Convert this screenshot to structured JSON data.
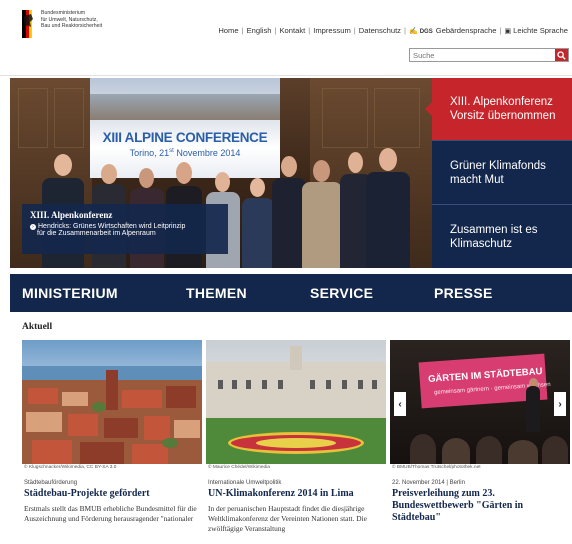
{
  "header": {
    "ministry_lines": [
      "Bundesministerium",
      "für Umwelt, Naturschutz,",
      "Bau und Reaktorsicherheit"
    ],
    "topnav": [
      {
        "label": "Home",
        "icon": ""
      },
      {
        "label": "English",
        "icon": ""
      },
      {
        "label": "Kontakt",
        "icon": ""
      },
      {
        "label": "Impressum",
        "icon": ""
      },
      {
        "label": "Datenschutz",
        "icon": ""
      },
      {
        "label": "Gebärdensprache",
        "icon": "sign-language-icon",
        "prefix": "DGS"
      },
      {
        "label": "Leichte Sprache",
        "icon": "easy-language-icon"
      }
    ],
    "search": {
      "placeholder": "Suche"
    }
  },
  "hero": {
    "banner": {
      "title": "XIII ALPINE CONFERENCE",
      "subtitle_city": "Torino, 21",
      "subtitle_sup": "st",
      "subtitle_rest": " Novembre 2014"
    },
    "caption": {
      "title": "XIII. Alpenkonferenz",
      "line1": "Hendricks: Grünes Wirtschaften wird Leitprinzip",
      "line2": "für die Zusammenarbeit im Alpenraum"
    },
    "teasers": [
      {
        "line1": "XIII. Alpenkonferenz",
        "line2": "Vorsitz übernommen",
        "active": true
      },
      {
        "line1": "Grüner Klimafonds",
        "line2": "macht Mut",
        "active": false
      },
      {
        "line1": "Zusammen ist es",
        "line2": "Klimaschutz",
        "active": false
      }
    ]
  },
  "mainnav": [
    "MINISTERIUM",
    "THEMEN",
    "SERVICE",
    "PRESSE"
  ],
  "aktuell": {
    "title": "Aktuell",
    "cards": [
      {
        "credit": "© Klugschnacker/Wikimedia, CC BY-SA 3.0",
        "kicker": "Städtebauförderung",
        "headline": "Städtebau-Projekte gefördert",
        "text": "Erstmals stellt das BMUB erhebliche Bundesmittel für die Auszeichnung und Förderung herausragender \"nationaler"
      },
      {
        "credit": "© Maurice Chédel/Wikimedia",
        "kicker": "Internationale Umweltpolitik",
        "headline": "UN-Klimakonferenz 2014 in Lima",
        "text": "In der peruanischen Hauptstadt findet die diesjährige Weltklimakonferenz der Vereinten Nationen statt. Die zwölftägige Veranstaltung"
      },
      {
        "credit": "© BMUB/Thomas Trutschel/photothek.net",
        "kicker": "22. November 2014 | Berlin",
        "headline": "Preisverleihung zum 23. Bundeswettbewerb \"Gärten in Städtebau\"",
        "text": "",
        "banner_line1": "GÄRTEN IM STÄDTEBAU",
        "banner_line2": "gemeinsam gärtnern · gemeinsam wachsen"
      }
    ]
  },
  "colors": {
    "navy": "#13274c",
    "red": "#c6252b"
  }
}
